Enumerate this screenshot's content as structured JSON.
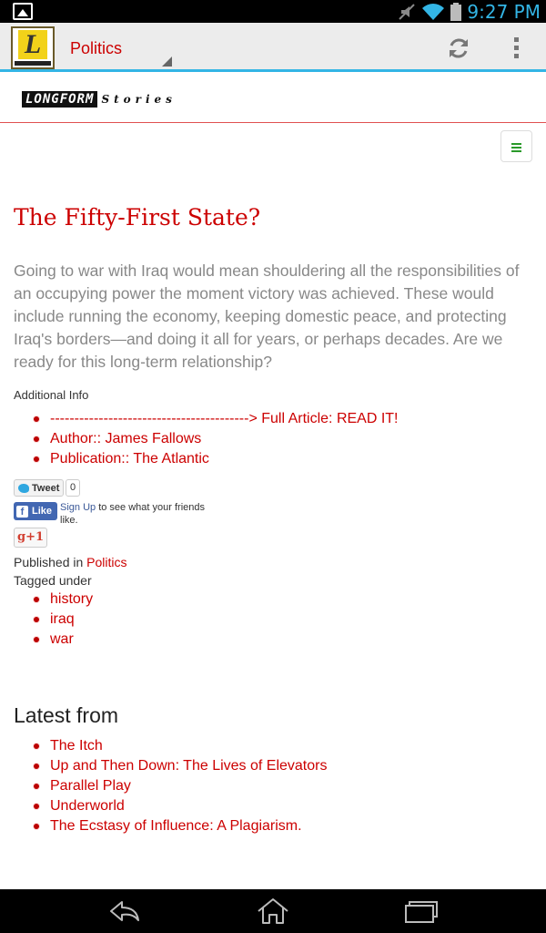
{
  "status_bar": {
    "time": "9:27 PM",
    "icons": [
      "gallery-notification-icon",
      "mute-icon",
      "wifi-icon",
      "battery-icon"
    ]
  },
  "action_bar": {
    "app_logo_letter": "L",
    "section": "Politics",
    "icons": [
      "refresh-icon",
      "overflow-menu-icon"
    ]
  },
  "site": {
    "logo_main": "LONGFORM",
    "logo_sub": "Stories",
    "menu_icon": "hamburger-icon"
  },
  "article": {
    "title": "The Fifty-First State?",
    "lede": "Going to war with Iraq would mean shouldering all the responsibilities of an occupying power the moment victory was achieved. These would include running the economy, keeping domestic peace, and protecting Iraq's borders—and doing it all for years, or perhaps decades. Are we ready for this long-term relationship?",
    "additional_info_label": "Additional Info",
    "full_article_prefix": "-----------------------------------------> Full Article:",
    "full_article_link": "READ IT!",
    "author_label": "Author::",
    "author": "James Fallows",
    "publication_label": "Publication::",
    "publication": "The Atlantic"
  },
  "social": {
    "tweet_label": "Tweet",
    "tweet_count": "0",
    "like_label": "Like",
    "fb_signup": "Sign Up",
    "fb_text": "to see what your friends like.",
    "gplus_label": "g+1"
  },
  "meta": {
    "published_in_label": "Published in",
    "published_in": "Politics",
    "tagged_under_label": "Tagged under",
    "tags": [
      "history",
      "iraq",
      "war"
    ]
  },
  "latest": {
    "title": "Latest from",
    "items": [
      "The Itch",
      "Up and Then Down: The Lives of Elevators",
      "Parallel Play",
      "Underworld",
      "The Ecstasy of Influence: A Plagiarism."
    ]
  },
  "nav_bar": {
    "icons": [
      "back-icon",
      "home-icon",
      "recent-apps-icon"
    ]
  },
  "colors": {
    "accent": "#cc0000",
    "holo_blue": "#33b5e5",
    "text_gray": "#888888"
  }
}
